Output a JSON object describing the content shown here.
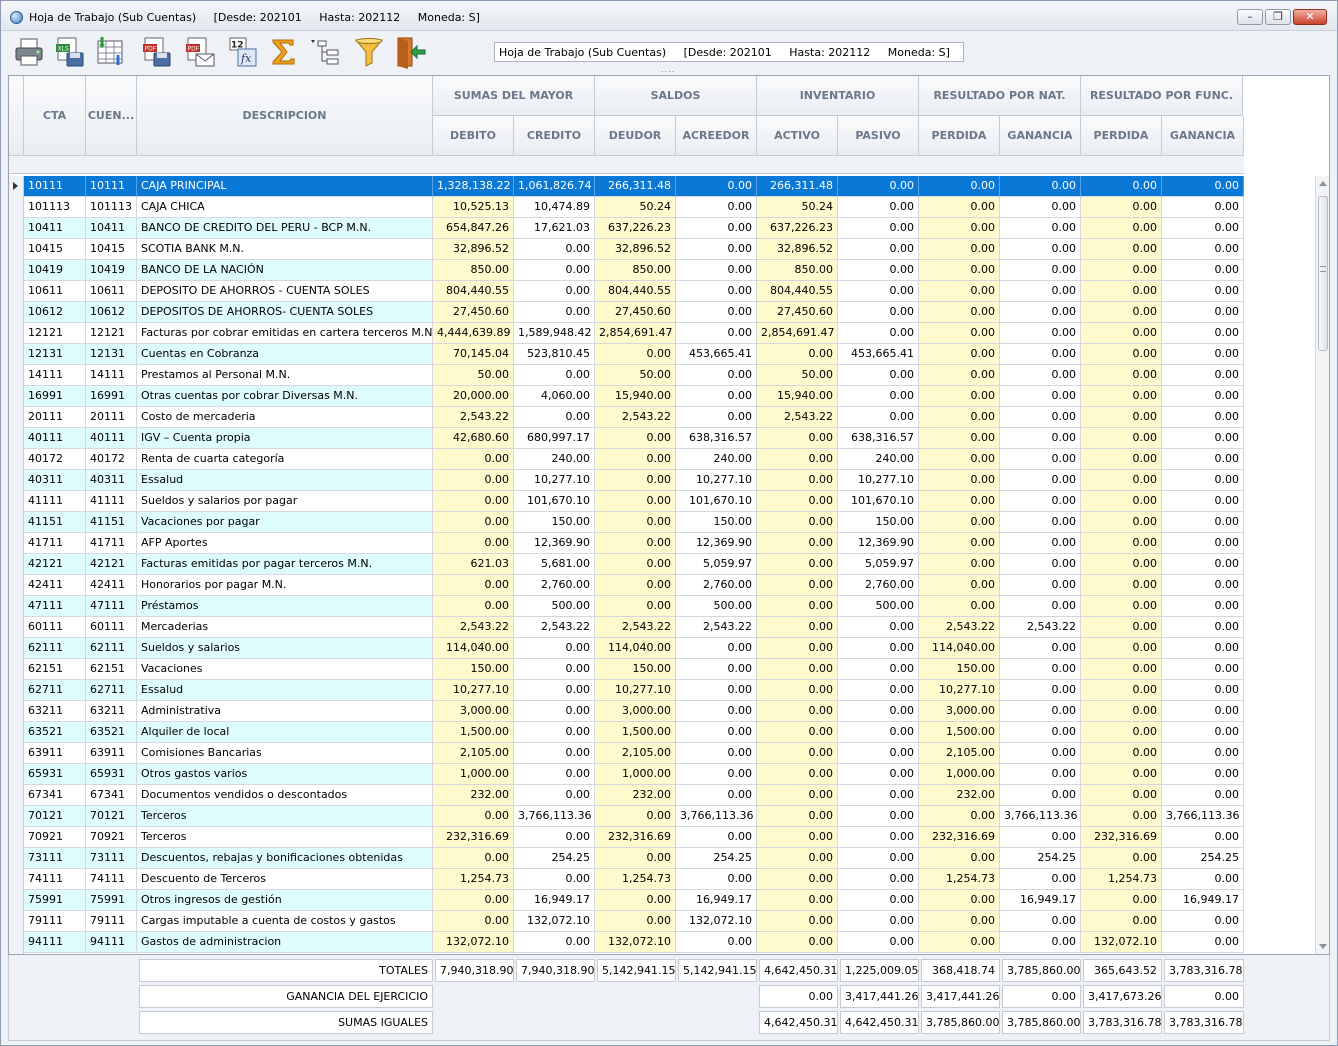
{
  "window": {
    "title": "Hoja de Trabajo (Sub Cuentas)     [Desde: 202101     Hasta: 202112     Moneda: S]"
  },
  "toolbar": {
    "buttons": [
      {
        "name": "print-icon"
      },
      {
        "name": "export-xls-icon"
      },
      {
        "name": "columns-icon"
      },
      {
        "name": "export-pdf-icon"
      },
      {
        "name": "pdf-mail-icon"
      },
      {
        "name": "formula-icon"
      },
      {
        "name": "sum-icon"
      },
      {
        "name": "tree-view-icon"
      },
      {
        "name": "filter-funnel-icon"
      },
      {
        "name": "exit-door-icon"
      }
    ],
    "filter_text": "Hoja de Trabajo (Sub Cuentas)     [Desde: 202101     Hasta: 202112     Moneda: S]",
    "grip": "...."
  },
  "grid": {
    "headers": {
      "cta": "CTA",
      "cuenta": "CUEN...",
      "descripcion": "DESCRIPCION",
      "groups": [
        "SUMAS DEL MAYOR",
        "SALDOS",
        "INVENTARIO",
        "RESULTADO POR NAT.",
        "RESULTADO POR FUNC."
      ],
      "subs": [
        "DEBITO",
        "CREDITO",
        "DEUDOR",
        "ACREEDOR",
        "ACTIVO",
        "PASIVO",
        "PERDIDA",
        "GANANCIA",
        "PERDIDA",
        "GANANCIA"
      ]
    },
    "rows": [
      [
        "10111",
        "10111",
        "CAJA PRINCIPAL",
        "1,328,138.22",
        "1,061,826.74",
        "266,311.48",
        "0.00",
        "266,311.48",
        "0.00",
        "0.00",
        "0.00",
        "0.00",
        "0.00"
      ],
      [
        "101113",
        "101113",
        "CAJA CHICA",
        "10,525.13",
        "10,474.89",
        "50.24",
        "0.00",
        "50.24",
        "0.00",
        "0.00",
        "0.00",
        "0.00",
        "0.00"
      ],
      [
        "10411",
        "10411",
        "BANCO DE CREDITO DEL PERU - BCP M.N.",
        "654,847.26",
        "17,621.03",
        "637,226.23",
        "0.00",
        "637,226.23",
        "0.00",
        "0.00",
        "0.00",
        "0.00",
        "0.00"
      ],
      [
        "10415",
        "10415",
        "SCOTIA BANK M.N.",
        "32,896.52",
        "0.00",
        "32,896.52",
        "0.00",
        "32,896.52",
        "0.00",
        "0.00",
        "0.00",
        "0.00",
        "0.00"
      ],
      [
        "10419",
        "10419",
        "BANCO DE LA NACIÓN",
        "850.00",
        "0.00",
        "850.00",
        "0.00",
        "850.00",
        "0.00",
        "0.00",
        "0.00",
        "0.00",
        "0.00"
      ],
      [
        "10611",
        "10611",
        "DEPOSITO DE AHORROS - CUENTA SOLES",
        "804,440.55",
        "0.00",
        "804,440.55",
        "0.00",
        "804,440.55",
        "0.00",
        "0.00",
        "0.00",
        "0.00",
        "0.00"
      ],
      [
        "10612",
        "10612",
        "DEPOSITOS DE AHORROS- CUENTA SOLES",
        "27,450.60",
        "0.00",
        "27,450.60",
        "0.00",
        "27,450.60",
        "0.00",
        "0.00",
        "0.00",
        "0.00",
        "0.00"
      ],
      [
        "12121",
        "12121",
        "Facturas por cobrar emitidas en cartera terceros M.N.",
        "4,444,639.89",
        "1,589,948.42",
        "2,854,691.47",
        "0.00",
        "2,854,691.47",
        "0.00",
        "0.00",
        "0.00",
        "0.00",
        "0.00"
      ],
      [
        "12131",
        "12131",
        "Cuentas en Cobranza",
        "70,145.04",
        "523,810.45",
        "0.00",
        "453,665.41",
        "0.00",
        "453,665.41",
        "0.00",
        "0.00",
        "0.00",
        "0.00"
      ],
      [
        "14111",
        "14111",
        "Prestamos al Personal M.N.",
        "50.00",
        "0.00",
        "50.00",
        "0.00",
        "50.00",
        "0.00",
        "0.00",
        "0.00",
        "0.00",
        "0.00"
      ],
      [
        "16991",
        "16991",
        "Otras cuentas por cobrar Diversas M.N.",
        "20,000.00",
        "4,060.00",
        "15,940.00",
        "0.00",
        "15,940.00",
        "0.00",
        "0.00",
        "0.00",
        "0.00",
        "0.00"
      ],
      [
        "20111",
        "20111",
        "Costo de mercaderia",
        "2,543.22",
        "0.00",
        "2,543.22",
        "0.00",
        "2,543.22",
        "0.00",
        "0.00",
        "0.00",
        "0.00",
        "0.00"
      ],
      [
        "40111",
        "40111",
        "IGV – Cuenta propia",
        "42,680.60",
        "680,997.17",
        "0.00",
        "638,316.57",
        "0.00",
        "638,316.57",
        "0.00",
        "0.00",
        "0.00",
        "0.00"
      ],
      [
        "40172",
        "40172",
        "Renta de cuarta categoría",
        "0.00",
        "240.00",
        "0.00",
        "240.00",
        "0.00",
        "240.00",
        "0.00",
        "0.00",
        "0.00",
        "0.00"
      ],
      [
        "40311",
        "40311",
        "Essalud",
        "0.00",
        "10,277.10",
        "0.00",
        "10,277.10",
        "0.00",
        "10,277.10",
        "0.00",
        "0.00",
        "0.00",
        "0.00"
      ],
      [
        "41111",
        "41111",
        "Sueldos y salarios por pagar",
        "0.00",
        "101,670.10",
        "0.00",
        "101,670.10",
        "0.00",
        "101,670.10",
        "0.00",
        "0.00",
        "0.00",
        "0.00"
      ],
      [
        "41151",
        "41151",
        "Vacaciones por pagar",
        "0.00",
        "150.00",
        "0.00",
        "150.00",
        "0.00",
        "150.00",
        "0.00",
        "0.00",
        "0.00",
        "0.00"
      ],
      [
        "41711",
        "41711",
        "AFP Aportes",
        "0.00",
        "12,369.90",
        "0.00",
        "12,369.90",
        "0.00",
        "12,369.90",
        "0.00",
        "0.00",
        "0.00",
        "0.00"
      ],
      [
        "42121",
        "42121",
        "Facturas emitidas por pagar terceros M.N.",
        "621.03",
        "5,681.00",
        "0.00",
        "5,059.97",
        "0.00",
        "5,059.97",
        "0.00",
        "0.00",
        "0.00",
        "0.00"
      ],
      [
        "42411",
        "42411",
        "Honorarios por pagar M.N.",
        "0.00",
        "2,760.00",
        "0.00",
        "2,760.00",
        "0.00",
        "2,760.00",
        "0.00",
        "0.00",
        "0.00",
        "0.00"
      ],
      [
        "47111",
        "47111",
        "Préstamos",
        "0.00",
        "500.00",
        "0.00",
        "500.00",
        "0.00",
        "500.00",
        "0.00",
        "0.00",
        "0.00",
        "0.00"
      ],
      [
        "60111",
        "60111",
        "Mercaderias",
        "2,543.22",
        "2,543.22",
        "2,543.22",
        "2,543.22",
        "0.00",
        "0.00",
        "2,543.22",
        "2,543.22",
        "0.00",
        "0.00"
      ],
      [
        "62111",
        "62111",
        "Sueldos y salarios",
        "114,040.00",
        "0.00",
        "114,040.00",
        "0.00",
        "0.00",
        "0.00",
        "114,040.00",
        "0.00",
        "0.00",
        "0.00"
      ],
      [
        "62151",
        "62151",
        "Vacaciones",
        "150.00",
        "0.00",
        "150.00",
        "0.00",
        "0.00",
        "0.00",
        "150.00",
        "0.00",
        "0.00",
        "0.00"
      ],
      [
        "62711",
        "62711",
        "Essalud",
        "10,277.10",
        "0.00",
        "10,277.10",
        "0.00",
        "0.00",
        "0.00",
        "10,277.10",
        "0.00",
        "0.00",
        "0.00"
      ],
      [
        "63211",
        "63211",
        "Administrativa",
        "3,000.00",
        "0.00",
        "3,000.00",
        "0.00",
        "0.00",
        "0.00",
        "3,000.00",
        "0.00",
        "0.00",
        "0.00"
      ],
      [
        "63521",
        "63521",
        "Alquiler de local",
        "1,500.00",
        "0.00",
        "1,500.00",
        "0.00",
        "0.00",
        "0.00",
        "1,500.00",
        "0.00",
        "0.00",
        "0.00"
      ],
      [
        "63911",
        "63911",
        "Comisiones Bancarias",
        "2,105.00",
        "0.00",
        "2,105.00",
        "0.00",
        "0.00",
        "0.00",
        "2,105.00",
        "0.00",
        "0.00",
        "0.00"
      ],
      [
        "65931",
        "65931",
        "Otros gastos varios",
        "1,000.00",
        "0.00",
        "1,000.00",
        "0.00",
        "0.00",
        "0.00",
        "1,000.00",
        "0.00",
        "0.00",
        "0.00"
      ],
      [
        "67341",
        "67341",
        "Documentos vendidos o descontados",
        "232.00",
        "0.00",
        "232.00",
        "0.00",
        "0.00",
        "0.00",
        "232.00",
        "0.00",
        "0.00",
        "0.00"
      ],
      [
        "70121",
        "70121",
        "Terceros",
        "0.00",
        "3,766,113.36",
        "0.00",
        "3,766,113.36",
        "0.00",
        "0.00",
        "0.00",
        "3,766,113.36",
        "0.00",
        "3,766,113.36"
      ],
      [
        "70921",
        "70921",
        "Terceros",
        "232,316.69",
        "0.00",
        "232,316.69",
        "0.00",
        "0.00",
        "0.00",
        "232,316.69",
        "0.00",
        "232,316.69",
        "0.00"
      ],
      [
        "73111",
        "73111",
        "Descuentos, rebajas y bonificaciones obtenidas",
        "0.00",
        "254.25",
        "0.00",
        "254.25",
        "0.00",
        "0.00",
        "0.00",
        "254.25",
        "0.00",
        "254.25"
      ],
      [
        "74111",
        "74111",
        "Descuento de Terceros",
        "1,254.73",
        "0.00",
        "1,254.73",
        "0.00",
        "0.00",
        "0.00",
        "1,254.73",
        "0.00",
        "1,254.73",
        "0.00"
      ],
      [
        "75991",
        "75991",
        "Otros ingresos de gestión",
        "0.00",
        "16,949.17",
        "0.00",
        "16,949.17",
        "0.00",
        "0.00",
        "0.00",
        "16,949.17",
        "0.00",
        "16,949.17"
      ],
      [
        "79111",
        "79111",
        "Cargas imputable a cuenta de costos y gastos",
        "0.00",
        "132,072.10",
        "0.00",
        "132,072.10",
        "0.00",
        "0.00",
        "0.00",
        "0.00",
        "0.00",
        "0.00"
      ],
      [
        "94111",
        "94111",
        "Gastos de administracion",
        "132,072.10",
        "0.00",
        "132,072.10",
        "0.00",
        "0.00",
        "0.00",
        "0.00",
        "0.00",
        "132,072.10",
        "0.00"
      ]
    ]
  },
  "footer": {
    "totales": {
      "label": "TOTALES",
      "values": [
        "7,940,318.90",
        "7,940,318.90",
        "5,142,941.15",
        "5,142,941.15",
        "4,642,450.31",
        "1,225,009.05",
        "368,418.74",
        "3,785,860.00",
        "365,643.52",
        "3,783,316.78"
      ]
    },
    "ganancia": {
      "label": "GANANCIA DEL EJERCICIO",
      "values": [
        "0.00",
        "3,417,441.26",
        "3,417,441.26",
        "0.00",
        "3,417,673.26",
        "0.00"
      ]
    },
    "sumas": {
      "label": "SUMAS IGUALES",
      "values": [
        "4,642,450.31",
        "4,642,450.31",
        "3,785,860.00",
        "3,785,860.00",
        "3,783,316.78",
        "3,783,316.78"
      ]
    }
  }
}
